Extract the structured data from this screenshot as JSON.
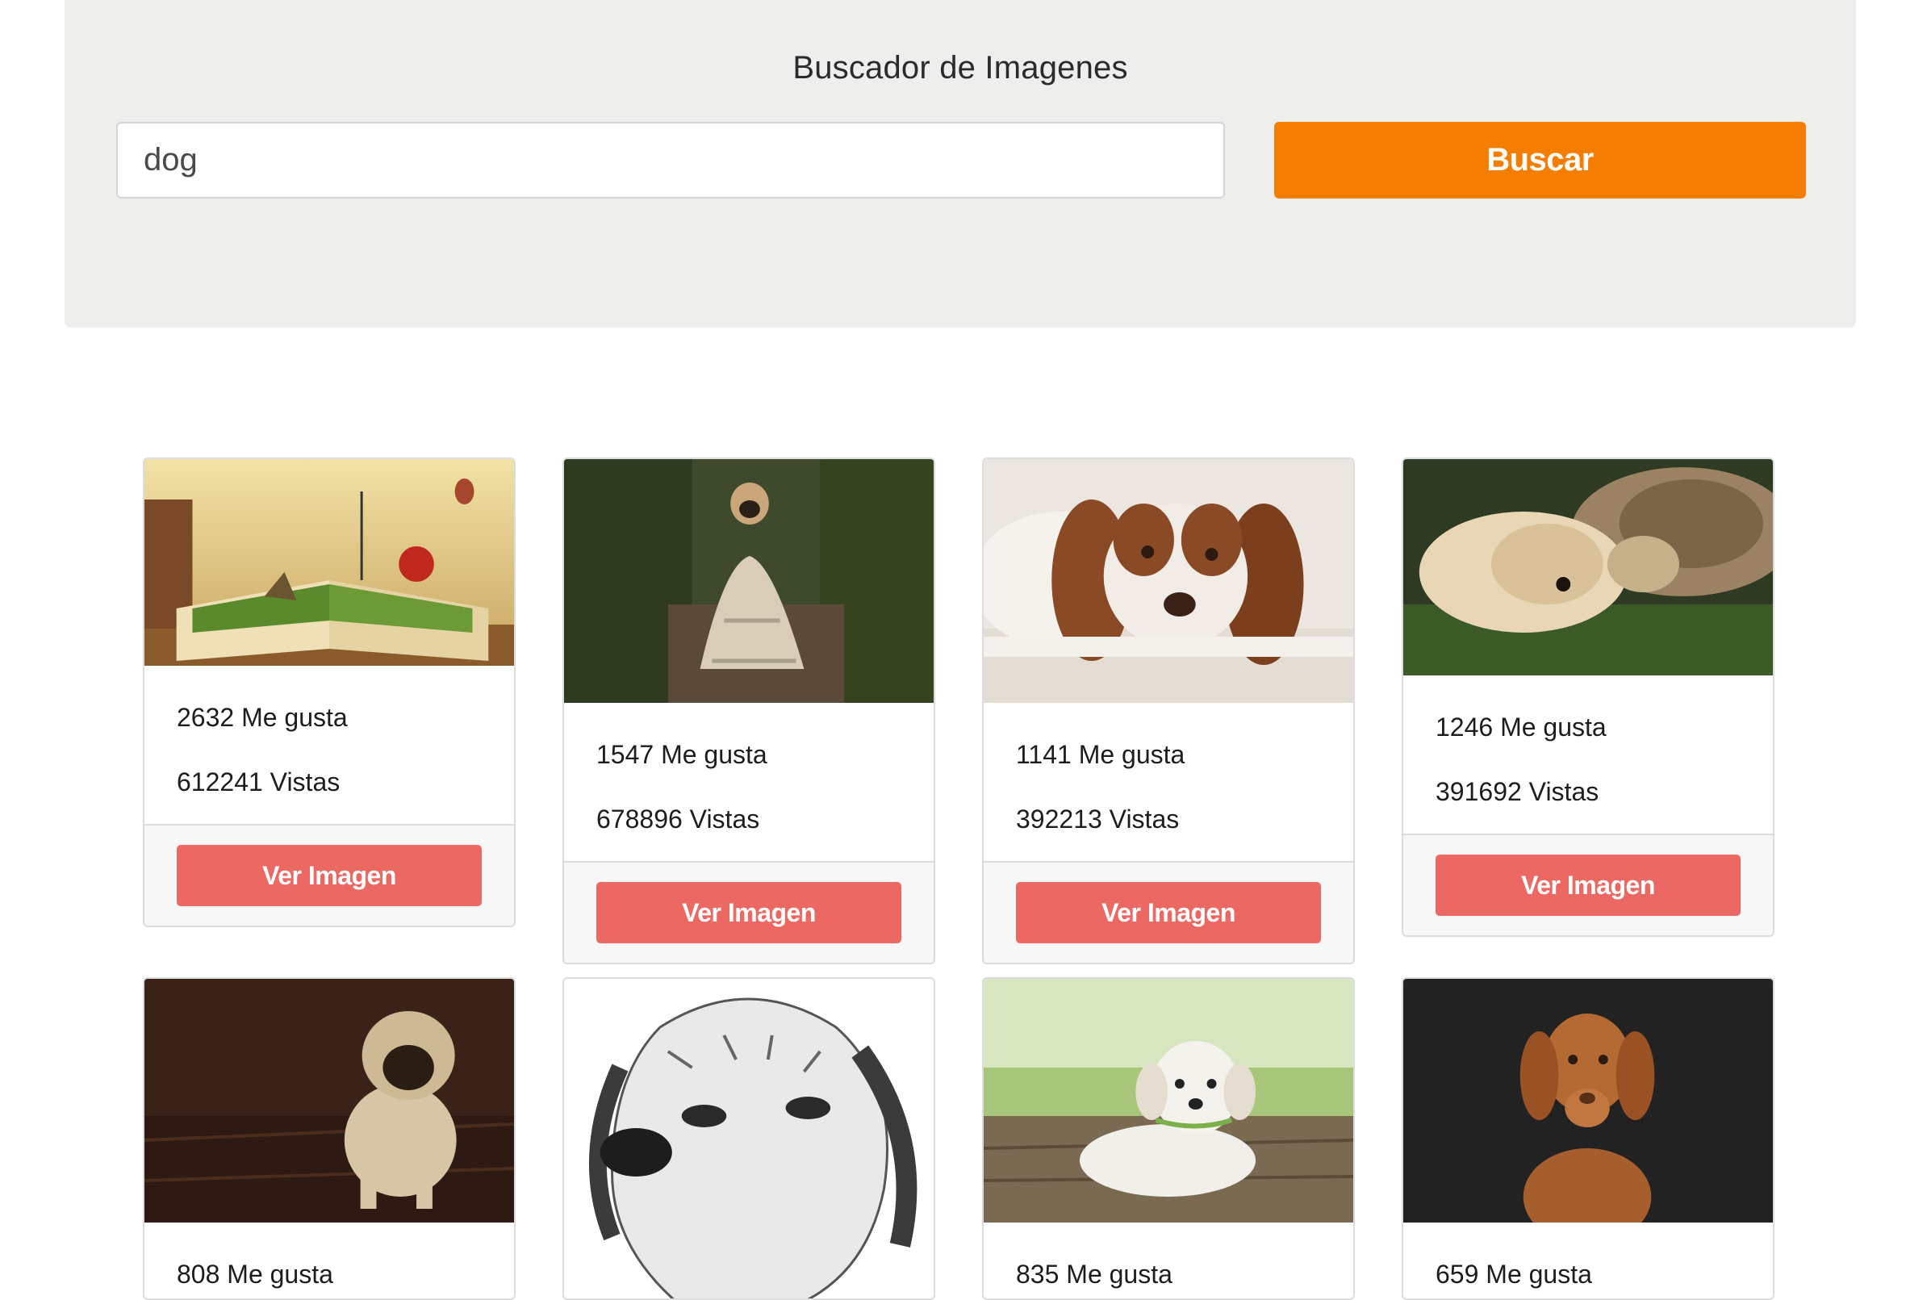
{
  "header": {
    "title": "Buscador de Imagenes",
    "search_value": "dog",
    "search_button_label": "Buscar"
  },
  "cards": [
    {
      "image": "book-landscape-illustration",
      "likes": "2632 Me gusta",
      "views": "612241 Vistas",
      "button_label": "Ver Imagen"
    },
    {
      "image": "pug-in-blanket-photo",
      "likes": "1547 Me gusta",
      "views": "678896 Vistas",
      "button_label": "Ver Imagen"
    },
    {
      "image": "spaniel-lying-photo",
      "likes": "1141 Me gusta",
      "views": "392213 Vistas",
      "button_label": "Ver Imagen"
    },
    {
      "image": "dog-and-cat-photo",
      "likes": "1246 Me gusta",
      "views": "391692 Vistas",
      "button_label": "Ver Imagen"
    },
    {
      "image": "pug-puppy-photo",
      "likes": "808 Me gusta",
      "views": "",
      "button_label": ""
    },
    {
      "image": "dog-sketch-drawing",
      "likes": "",
      "views": "",
      "button_label": ""
    },
    {
      "image": "white-puppy-photo",
      "likes": "835 Me gusta",
      "views": "",
      "button_label": ""
    },
    {
      "image": "vizsla-dog-photo",
      "likes": "659 Me gusta",
      "views": "",
      "button_label": ""
    }
  ],
  "colors": {
    "jumbotron_bg": "#eeeeec",
    "search_button": "#f57d00",
    "view_button": "#ec6863"
  }
}
